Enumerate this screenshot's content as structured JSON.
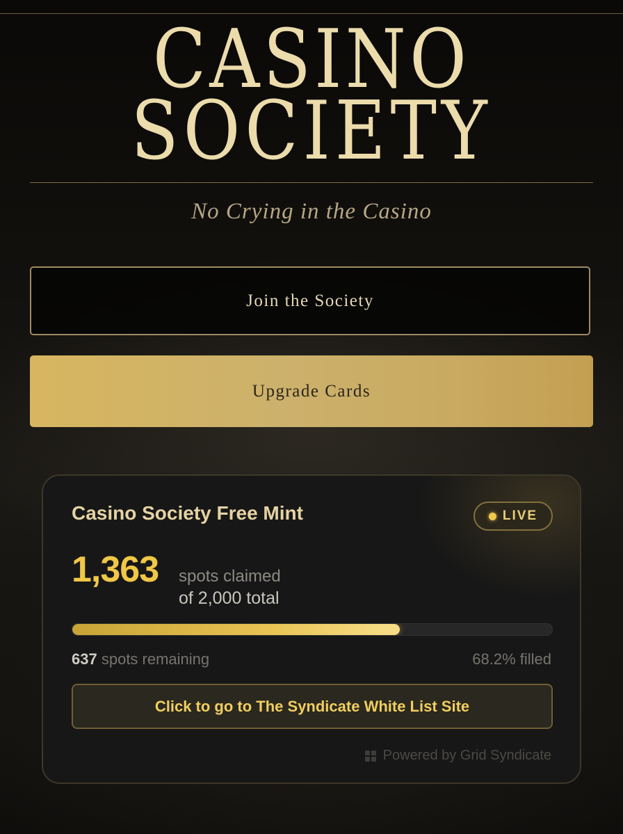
{
  "header": {
    "logo_line_1": "CASINO",
    "logo_line_2": "SOCIETY",
    "tagline": "No Crying in the Casino"
  },
  "actions": {
    "join_label": "Join the Society",
    "upgrade_label": "Upgrade Cards"
  },
  "mint_card": {
    "title": "Casino Society Free Mint",
    "status_badge": "LIVE",
    "claimed_count": "1,363",
    "claimed_label": "spots claimed",
    "total_label": "of 2,000 total",
    "progress_fraction": 0.682,
    "remaining_count": "637",
    "remaining_label": "spots remaining",
    "filled_label": "68.2% filled",
    "link_label": "Click to go to The Syndicate White List Site",
    "powered_by": "Powered by Grid Syndicate"
  },
  "icons": {
    "live_indicator": "live-dot-icon",
    "powered_by": "grid-icon"
  },
  "colors": {
    "gold_accent": "#f0c747",
    "logo_cream": "#ecdcac",
    "upgrade_gold": "#d7b65f",
    "card_background": "#171717"
  }
}
